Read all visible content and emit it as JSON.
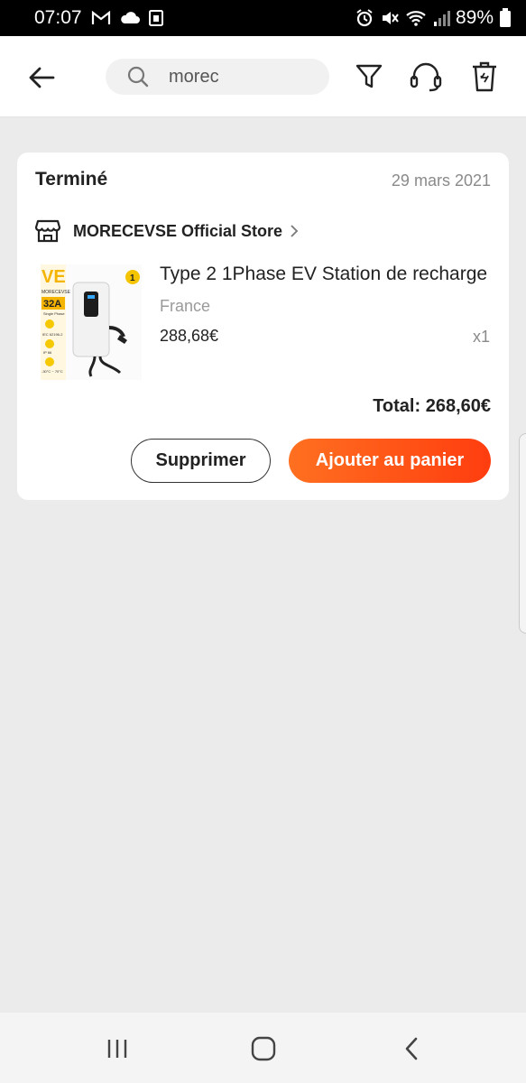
{
  "status_bar": {
    "time": "07:07",
    "battery": "89%",
    "left_icons": [
      "gmail-icon",
      "cloud-icon",
      "sim-icon"
    ],
    "right_icons": [
      "alarm-icon",
      "mute-icon",
      "wifi-icon",
      "signal-icon",
      "battery-icon"
    ]
  },
  "header": {
    "search_text": "morec",
    "icons": [
      "back-arrow-icon",
      "search-icon",
      "filter-icon",
      "headset-icon",
      "trash-icon"
    ]
  },
  "order": {
    "status": "Terminé",
    "date": "29 mars 2021",
    "store": "MORECEVSE Official Store",
    "product": {
      "title": "Type 2 1Phase EV Station de recharge",
      "origin": "France",
      "price": "288,68€",
      "quantity": "x1",
      "image_labels": {
        "brand": "MORECEVSE",
        "amperage": "32A",
        "phase": "Single Phase",
        "standard": "IEC 62196-2",
        "ip": "IP 66",
        "temp": "-30°C ~ 70°C",
        "badge": "1"
      }
    },
    "total": "Total: 268,60€",
    "delete_label": "Supprimer",
    "add_to_cart_label": "Ajouter au panier"
  },
  "nav": {
    "icons": [
      "recent-apps-icon",
      "home-icon",
      "back-icon"
    ]
  },
  "colors": {
    "accent_start": "#ff7020",
    "accent_end": "#ff3d0f",
    "background": "#ebebeb"
  }
}
